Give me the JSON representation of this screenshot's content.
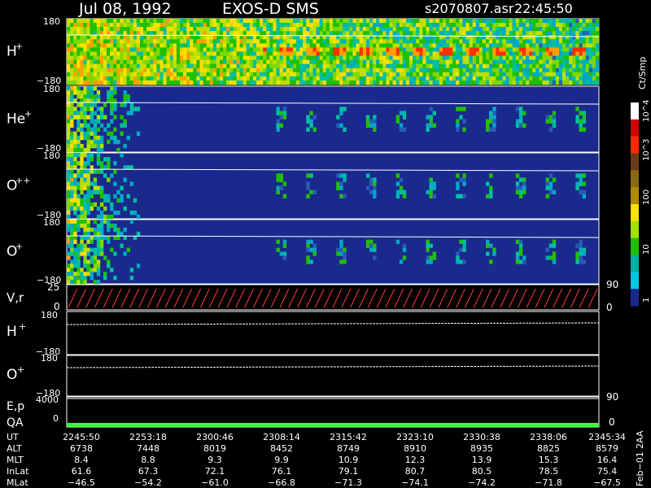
{
  "header": {
    "date": "Jul 08, 1992",
    "instrument": "EXOS-D SMS",
    "file": "s2070807.asr",
    "time": "22:45:50"
  },
  "colors": {
    "background": "#000000",
    "spectrogram_background": "#1a2a8c",
    "text": "#ffffff",
    "sawtooth": "#ff3b3b",
    "qa_bar": "#3cff3c"
  },
  "panels": [
    {
      "name": "h-plus",
      "label": "H",
      "sup": "+",
      "ytop": "180",
      "ybot": "−180",
      "activity": "high"
    },
    {
      "name": "he-plus",
      "label": "He",
      "sup": "+",
      "ytop": "180",
      "ybot": "−180",
      "activity": "medium"
    },
    {
      "name": "o-plus-plus",
      "label": "O",
      "sup": "++",
      "ytop": "180",
      "ybot": "−180",
      "activity": "medium"
    },
    {
      "name": "o-plus",
      "label": "O",
      "sup": "+",
      "ytop": "180",
      "ybot": "−180",
      "activity": "medium"
    }
  ],
  "vr": {
    "label": "V,r",
    "ytop": "25",
    "ybot": "0",
    "right_top": "90",
    "right_bot": "0"
  },
  "lower_panels": [
    {
      "name": "h-plus-lower",
      "label": "H",
      "sup": "+",
      "ytop": "180",
      "ybot": "−180"
    },
    {
      "name": "o-plus-lower",
      "label": "O",
      "sup": "+",
      "ytop": "180",
      "ybot": "−180"
    }
  ],
  "ep": {
    "label": "E,p",
    "ytop": "4000",
    "right": "90"
  },
  "qa": {
    "label": "QA",
    "ybot": "0",
    "right": "0"
  },
  "colorbar": {
    "unit": "Ct/Smp",
    "labels": [
      "10^4",
      "10^3",
      "100",
      "10",
      "1"
    ],
    "stops": [
      "#ffffff",
      "#d40000",
      "#ff2a00",
      "#6b3a1a",
      "#8a6a10",
      "#b08a00",
      "#ffe000",
      "#a0e000",
      "#20c000",
      "#00b0a0",
      "#00c8e0",
      "#1a2a8c"
    ]
  },
  "ephemeris": {
    "row_labels": [
      "UT",
      "ALT",
      "MLT",
      "InLat",
      "MLat"
    ],
    "columns": [
      [
        "2245:50",
        "6738",
        "8.4",
        "61.6",
        "−46.5"
      ],
      [
        "2253:18",
        "7448",
        "8.8",
        "67.3",
        "−54.2"
      ],
      [
        "2300:46",
        "8019",
        "9.3",
        "72.1",
        "−61.0"
      ],
      [
        "2308:14",
        "8452",
        "9.9",
        "76.1",
        "−66.8"
      ],
      [
        "2315:42",
        "8749",
        "10.9",
        "79.1",
        "−71.3"
      ],
      [
        "2323:10",
        "8910",
        "12.3",
        "80.7",
        "−74.1"
      ],
      [
        "2330:38",
        "8935",
        "13.9",
        "80.5",
        "−74.2"
      ],
      [
        "2338:06",
        "8825",
        "15.3",
        "78.5",
        "−71.8"
      ],
      [
        "2345:34",
        "8579",
        "16.4",
        "75.4",
        "−67.5"
      ]
    ]
  },
  "footer": {
    "stamp": "Feb−01 2AA"
  }
}
